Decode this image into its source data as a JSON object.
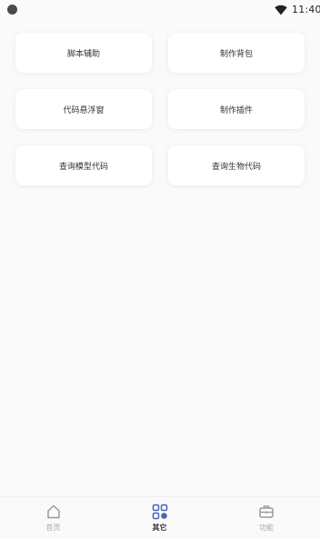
{
  "status_bar": {
    "time": "11:40",
    "icons": [
      "camera-dot-icon",
      "wifi-icon"
    ]
  },
  "cards": [
    {
      "label": "脚本辅助"
    },
    {
      "label": "制作背包"
    },
    {
      "label": "代码悬浮窗"
    },
    {
      "label": "制作插件"
    },
    {
      "label": "查询模型代码"
    },
    {
      "label": "查询生物代码"
    }
  ],
  "bottom_nav": {
    "items": [
      {
        "label": "首页",
        "icon": "home-icon",
        "active": false
      },
      {
        "label": "其它",
        "icon": "grid-icon",
        "active": true
      },
      {
        "label": "功能",
        "icon": "toolbox-icon",
        "active": false
      }
    ]
  },
  "colors": {
    "accent": "#4a63b8",
    "background": "#fafafa",
    "card": "#ffffff",
    "inactive": "#aaaaaa"
  }
}
